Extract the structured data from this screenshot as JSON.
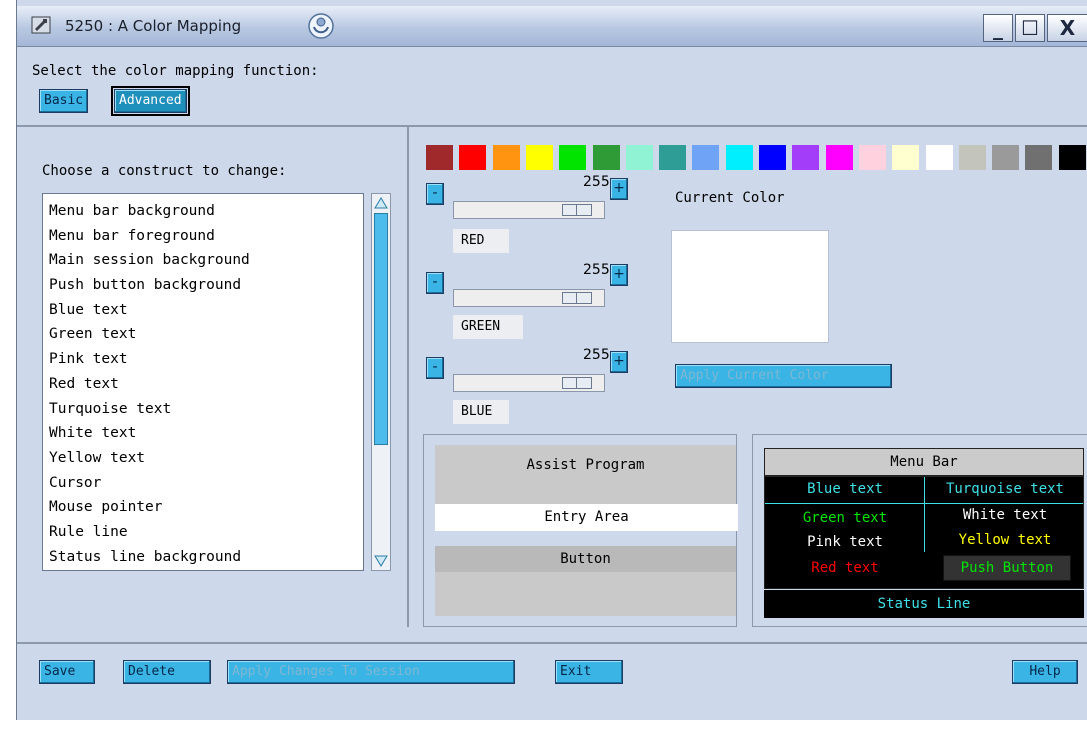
{
  "window": {
    "title": "5250 : A  Color Mapping",
    "controls": {
      "minimize": "_",
      "maximize": "☐",
      "close": "X"
    }
  },
  "function_panel": {
    "label": "Select the color mapping function:",
    "options": [
      "Basic",
      "Advanced"
    ],
    "selected": "Advanced"
  },
  "constructs": {
    "label": "Choose a construct to change:",
    "items": [
      "Menu bar background",
      "Menu bar foreground",
      "Main session background",
      "Push button background",
      "Blue text",
      "Green text",
      "Pink text",
      "Red text",
      "Turquoise text",
      "White text",
      "Yellow text",
      "Cursor",
      "Mouse pointer",
      "Rule line",
      "Status line background"
    ]
  },
  "palette": [
    "#a0292b",
    "#ff0000",
    "#ff9410",
    "#ffff00",
    "#00e400",
    "#2e9b36",
    "#8ff3d4",
    "#2d9d95",
    "#6fa3f5",
    "#00efff",
    "#0000ff",
    "#a43dfa",
    "#ff00ff",
    "#ffd1de",
    "#ffffd0",
    "#ffffff",
    "#c3c5bd",
    "#9a9a9a",
    "#707070",
    "#000000"
  ],
  "sliders": {
    "red": {
      "label": "RED",
      "value": "255",
      "level": 1.0
    },
    "green": {
      "label": "GREEN",
      "value": "255",
      "level": 1.0
    },
    "blue": {
      "label": "BLUE",
      "value": "255",
      "level": 1.0
    },
    "minus": "-",
    "plus": "+"
  },
  "current_color": {
    "label": "Current Color",
    "color": "#ffffff",
    "apply_label": "Apply Current Color"
  },
  "preview_assist": {
    "title": "Assist Program",
    "entry": "Entry Area",
    "button": "Button"
  },
  "preview_session": {
    "menu_bar": "Menu Bar",
    "cells": {
      "blue": {
        "text": "Blue text",
        "color": "#3ee0e6"
      },
      "turquoise": {
        "text": "Turquoise text",
        "color": "#3ee0e6"
      },
      "green": {
        "text": "Green text",
        "color": "#00e400"
      },
      "white": {
        "text": "White text",
        "color": "#ffffff"
      },
      "pink": {
        "text": "Pink text",
        "color": "#ffffff"
      },
      "yellow": {
        "text": "Yellow text",
        "color": "#ffff00"
      },
      "red": {
        "text": "Red text",
        "color": "#ff0000"
      },
      "push": {
        "text": "Push Button",
        "color": "#00e400"
      }
    },
    "status_line": "Status Line"
  },
  "bottom": {
    "save": "Save",
    "delete": "Delete",
    "apply": "Apply Changes To Session",
    "exit": "Exit",
    "help": "Help"
  }
}
